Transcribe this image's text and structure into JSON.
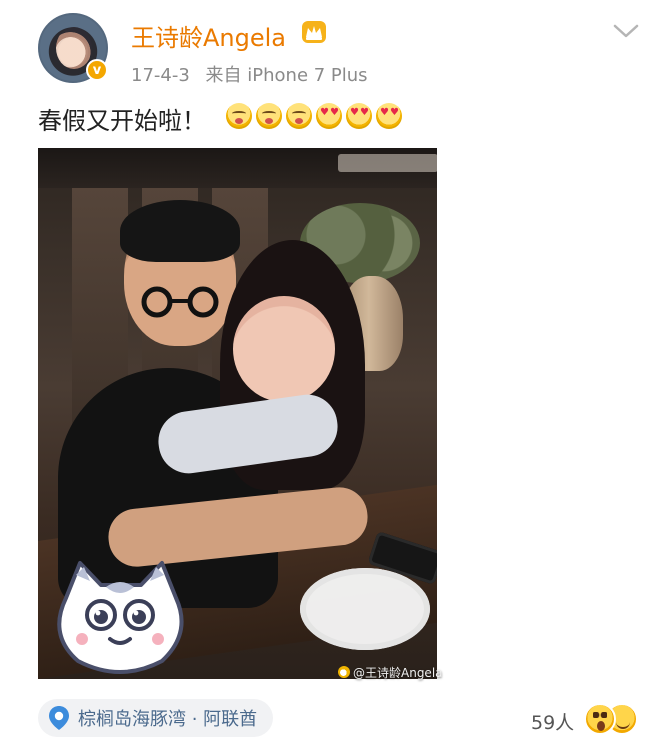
{
  "post": {
    "author": "王诗龄Angela",
    "date": "17-4-3",
    "source": "来自 iPhone 7 Plus",
    "text": "春假又开始啦！",
    "emojis": [
      "kiss",
      "kiss",
      "kiss",
      "heart-eyes",
      "heart-eyes",
      "heart-eyes"
    ],
    "watermark": "@王诗龄Angela"
  },
  "location": {
    "label": "棕榈岛海豚湾 · 阿联酋",
    "icon": "location-pin-icon"
  },
  "reactions": {
    "count_label": "59人",
    "icons": [
      "surprised-face-icon",
      "grinning-face-icon"
    ]
  },
  "colors": {
    "author_name": "#ea7a00",
    "meta_text": "#8a8a8a",
    "location_text": "#4b6a8d",
    "verified_badge": "#f4a700",
    "location_bg": "#f1f2f4"
  }
}
